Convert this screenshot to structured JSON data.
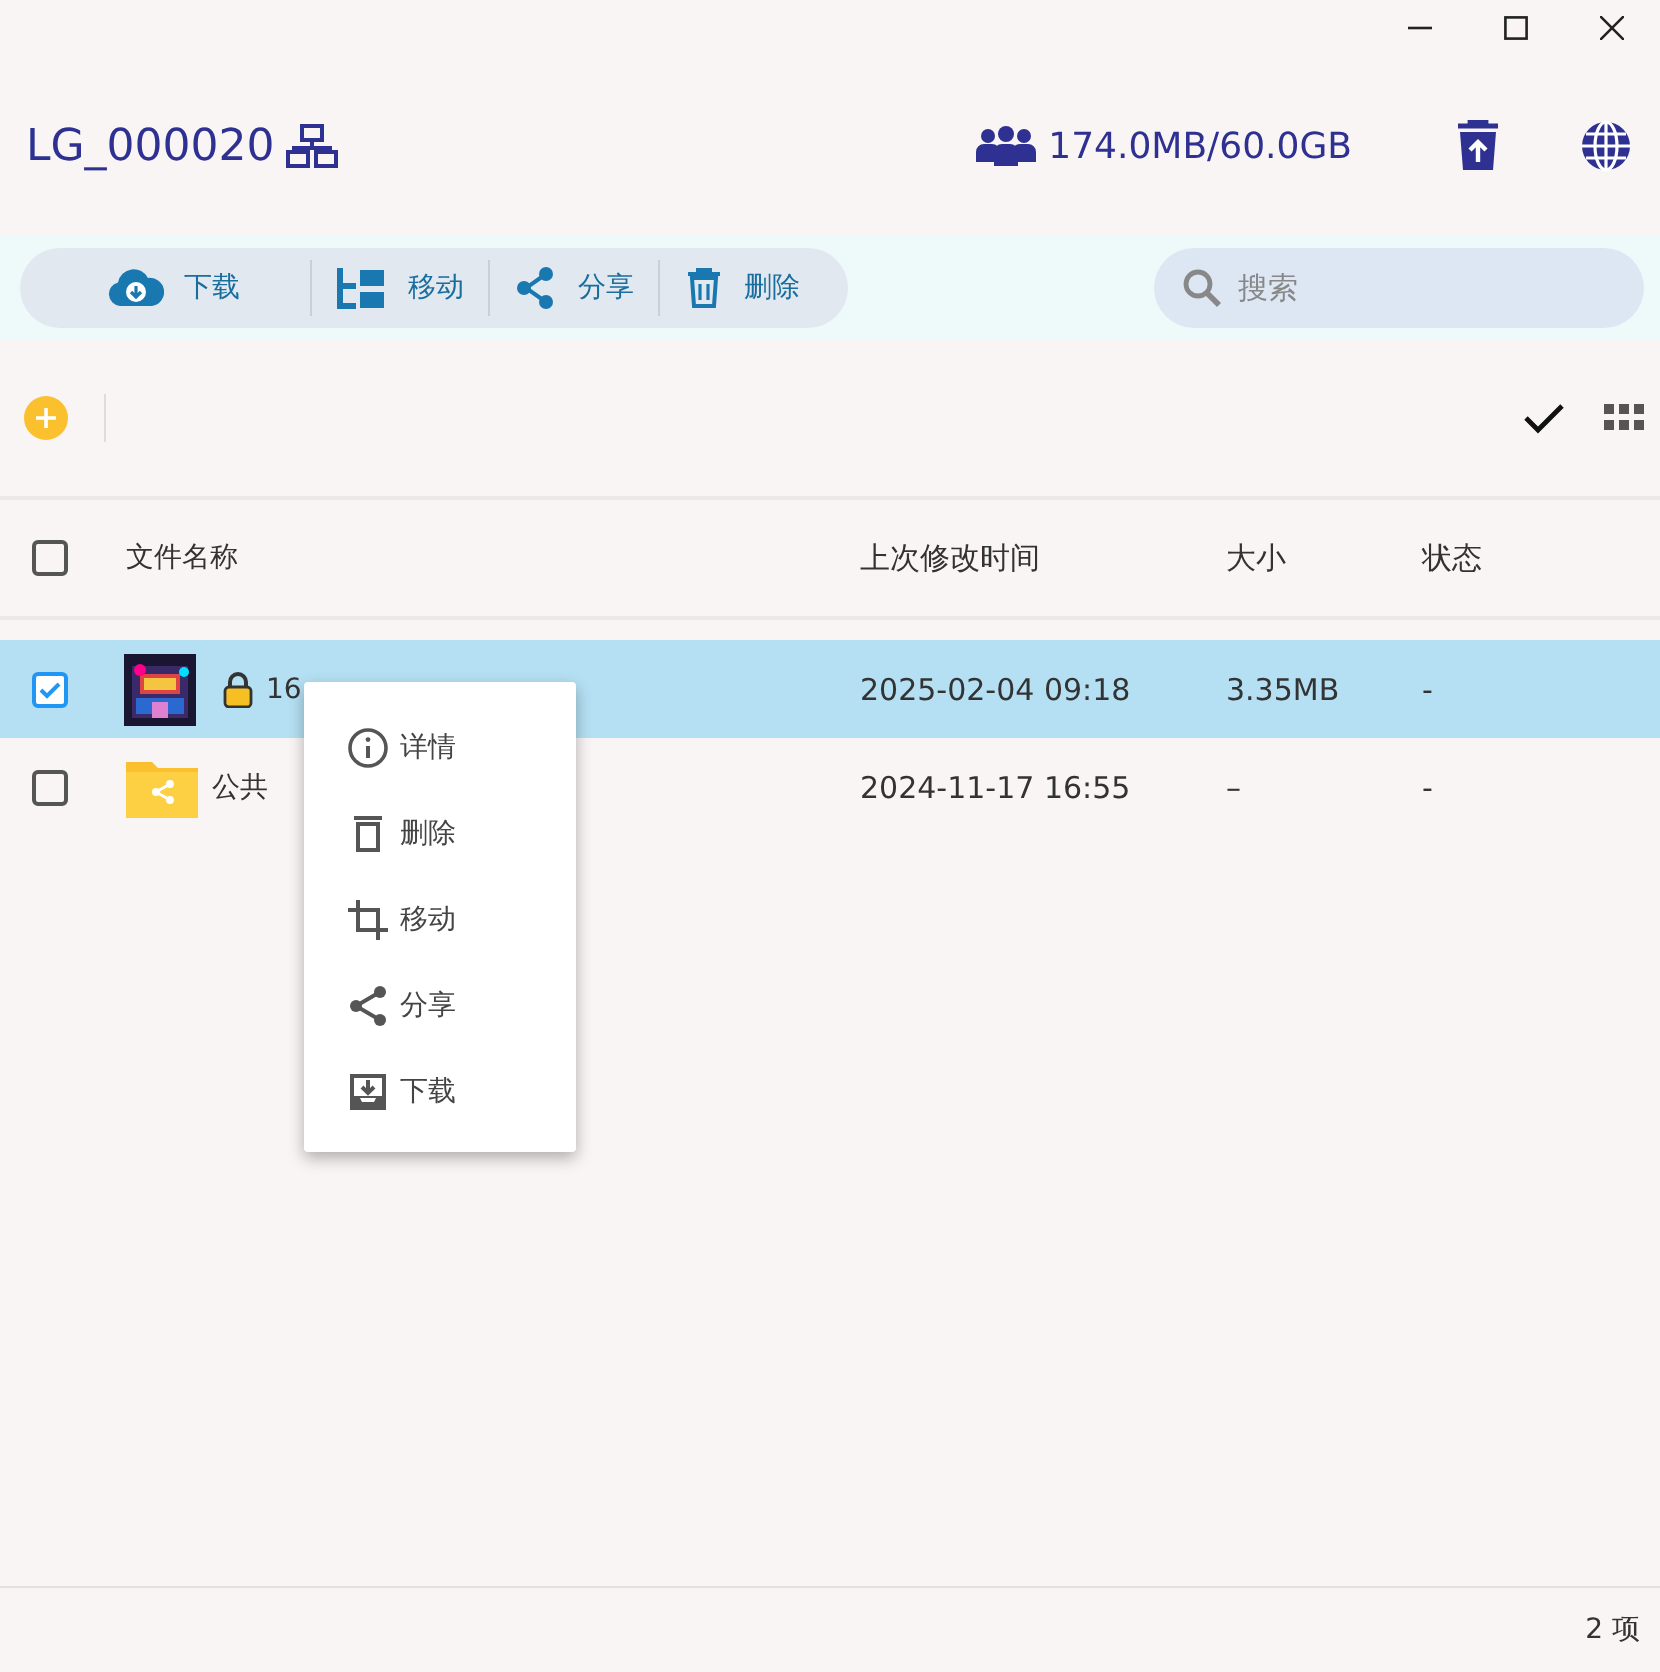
{
  "header": {
    "title": "LG_000020",
    "storage": "174.0MB/60.0GB"
  },
  "toolbar": {
    "actions": [
      {
        "kind": "download",
        "label": "下载"
      },
      {
        "kind": "move",
        "label": "移动"
      },
      {
        "kind": "share",
        "label": "分享"
      },
      {
        "kind": "delete",
        "label": "删除"
      }
    ],
    "search": {
      "placeholder": "搜索"
    }
  },
  "table": {
    "columns": [
      "文件名称",
      "上次修改时间",
      "大小",
      "状态"
    ],
    "all_checked": false,
    "rows": [
      {
        "name": "16",
        "locked": true,
        "modified": "2025-02-04 09:18",
        "size": "3.35MB",
        "status": "-",
        "checked": true,
        "selected": true
      },
      {
        "kind": "shared-folder",
        "name": "公共",
        "locked": false,
        "modified": "2024-11-17 16:55",
        "size": "–",
        "status": "-",
        "checked": false,
        "selected": false
      }
    ]
  },
  "context_menu": {
    "items": [
      {
        "kind": "info",
        "label": "详情"
      },
      {
        "kind": "delete",
        "label": "删除"
      },
      {
        "kind": "move",
        "label": "移动"
      },
      {
        "kind": "share",
        "label": "分享"
      },
      {
        "kind": "download",
        "label": "下载"
      }
    ]
  },
  "status_bar": {
    "count": "2 项"
  }
}
